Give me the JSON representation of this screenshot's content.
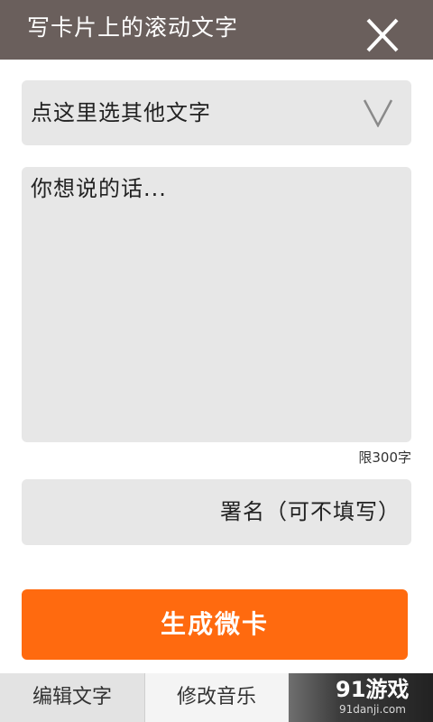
{
  "header": {
    "title": "写卡片上的滚动文字",
    "close_label": "X"
  },
  "text_picker": {
    "label": "点这里选其他文字",
    "icon": "chevron-down-icon"
  },
  "message": {
    "placeholder": "你想说的话...",
    "limit_note": "限300字"
  },
  "signature": {
    "placeholder": "署名（可不填写）"
  },
  "generate_button": {
    "label": "生成微卡"
  },
  "tabs": [
    {
      "label": "编辑文字"
    },
    {
      "label": "修改音乐"
    }
  ],
  "watermark": {
    "logo": "91游戏",
    "url": "91danji.com"
  },
  "colors": {
    "title_bar": "#6a5f5c",
    "field_bg": "#e7e7e7",
    "accent": "#ff6a0f"
  }
}
